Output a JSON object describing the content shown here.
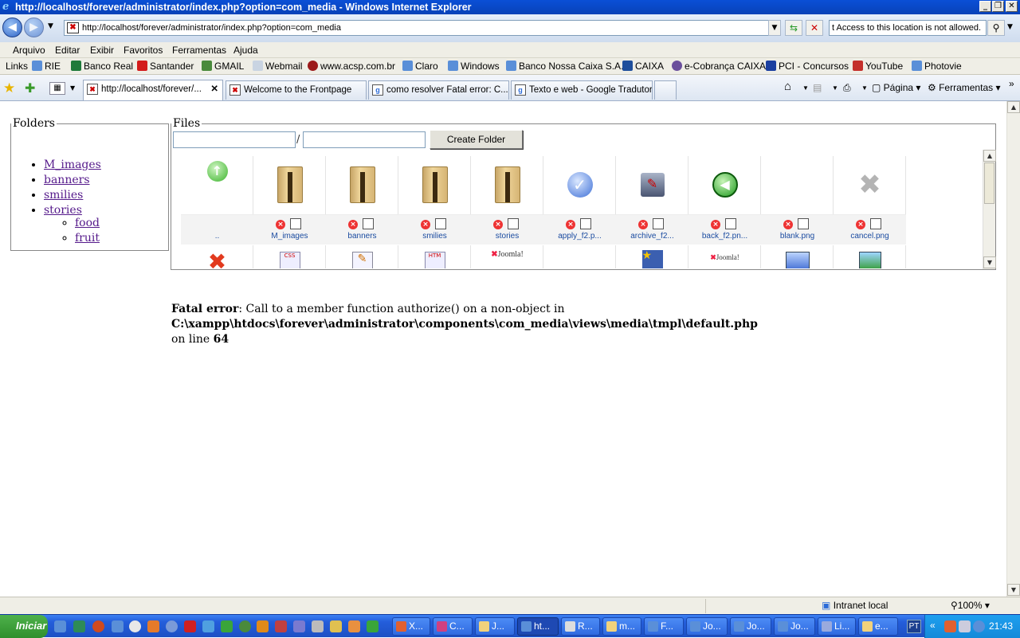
{
  "window": {
    "title": "http://localhost/forever/administrator/index.php?option=com_media - Windows Internet Explorer"
  },
  "address": {
    "url": "http://localhost/forever/administrator/index.php?option=com_media",
    "search_value": "t Access to this location is not allowed."
  },
  "menu": [
    "Arquivo",
    "Editar",
    "Exibir",
    "Favoritos",
    "Ferramentas",
    "Ajuda"
  ],
  "links": {
    "label": "Links",
    "items": [
      "RIE",
      "Banco Real",
      "Santander",
      "GMAIL",
      "Webmail",
      "www.acsp.com.br",
      "Claro",
      "Windows",
      "Banco Nossa Caixa S.A.",
      "CAIXA",
      "e-Cobrança CAIXA",
      "PCI - Concursos",
      "YouTube",
      "Photovie"
    ]
  },
  "tabs": [
    {
      "label": "http://localhost/forever/..."
    },
    {
      "label": "Welcome to the Frontpage"
    },
    {
      "label": "como resolver Fatal error: C..."
    },
    {
      "label": "Texto e web - Google Tradutor"
    }
  ],
  "toolbar": {
    "page": "Página",
    "tools": "Ferramentas"
  },
  "folders": {
    "legend": "Folders",
    "items": [
      "M_images",
      "banners",
      "smilies",
      "stories"
    ],
    "sub": [
      "food",
      "fruit"
    ]
  },
  "files": {
    "legend": "Files",
    "path_sep": "/",
    "create_label": "Create Folder",
    "up_label": "..",
    "items": [
      "M_images",
      "banners",
      "smilies",
      "stories",
      "apply_f2.p...",
      "archive_f2...",
      "back_f2.pn...",
      "blank.png",
      "cancel.png"
    ]
  },
  "error": {
    "label": "Fatal error",
    "message": ": Call to a member function authorize() on a non-object in ",
    "path": "C:\\xampp\\htdocs\\forever\\administrator\\components\\com_media\\views\\media\\tmpl\\default.php",
    "online": "on line ",
    "line": "64"
  },
  "status": {
    "zone": "Intranet local",
    "zoom": "100%"
  },
  "taskbar": {
    "start": "Iniciar",
    "tasks": [
      "X...",
      "C...",
      "J...",
      "ht...",
      "R...",
      "m...",
      "F...",
      "Jo...",
      "Jo...",
      "Jo...",
      "Li...",
      "e..."
    ],
    "lang": "PT",
    "clock": "21:43"
  }
}
